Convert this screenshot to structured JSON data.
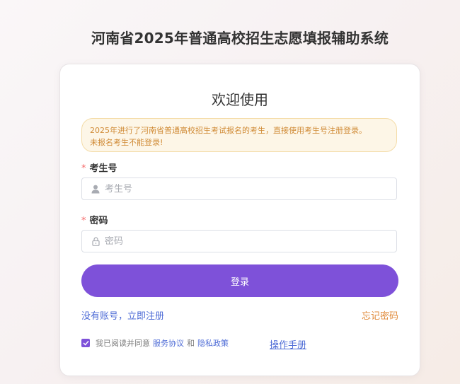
{
  "app_title": "河南省2025年普通高校招生志愿填报辅助系统",
  "login_card": {
    "welcome": "欢迎使用",
    "notice_line1": "2025年进行了河南省普通高校招生考试报名的考生，直接使用考生号注册登录。",
    "notice_line2": "未报名考生不能登录!",
    "required_mark": "*",
    "exam_number": {
      "label": "考生号",
      "placeholder": "考生号",
      "value": "",
      "icon": "user-icon"
    },
    "password": {
      "label": "密码",
      "placeholder": "密码",
      "value": "",
      "icon": "lock-icon"
    },
    "login_button": "登录",
    "register_link": "没有账号，立即注册",
    "forgot_link": "忘记密码",
    "agreement": {
      "checked": true,
      "prefix": "我已阅读并同意",
      "service_link": "服务协议",
      "and": "和",
      "privacy_link": "隐私政策"
    },
    "manual_link": "操作手册"
  },
  "colors": {
    "accent": "#7e51d9",
    "link": "#4d6bd6",
    "warning_text": "#d08a35",
    "forgot": "#e08a3a"
  }
}
